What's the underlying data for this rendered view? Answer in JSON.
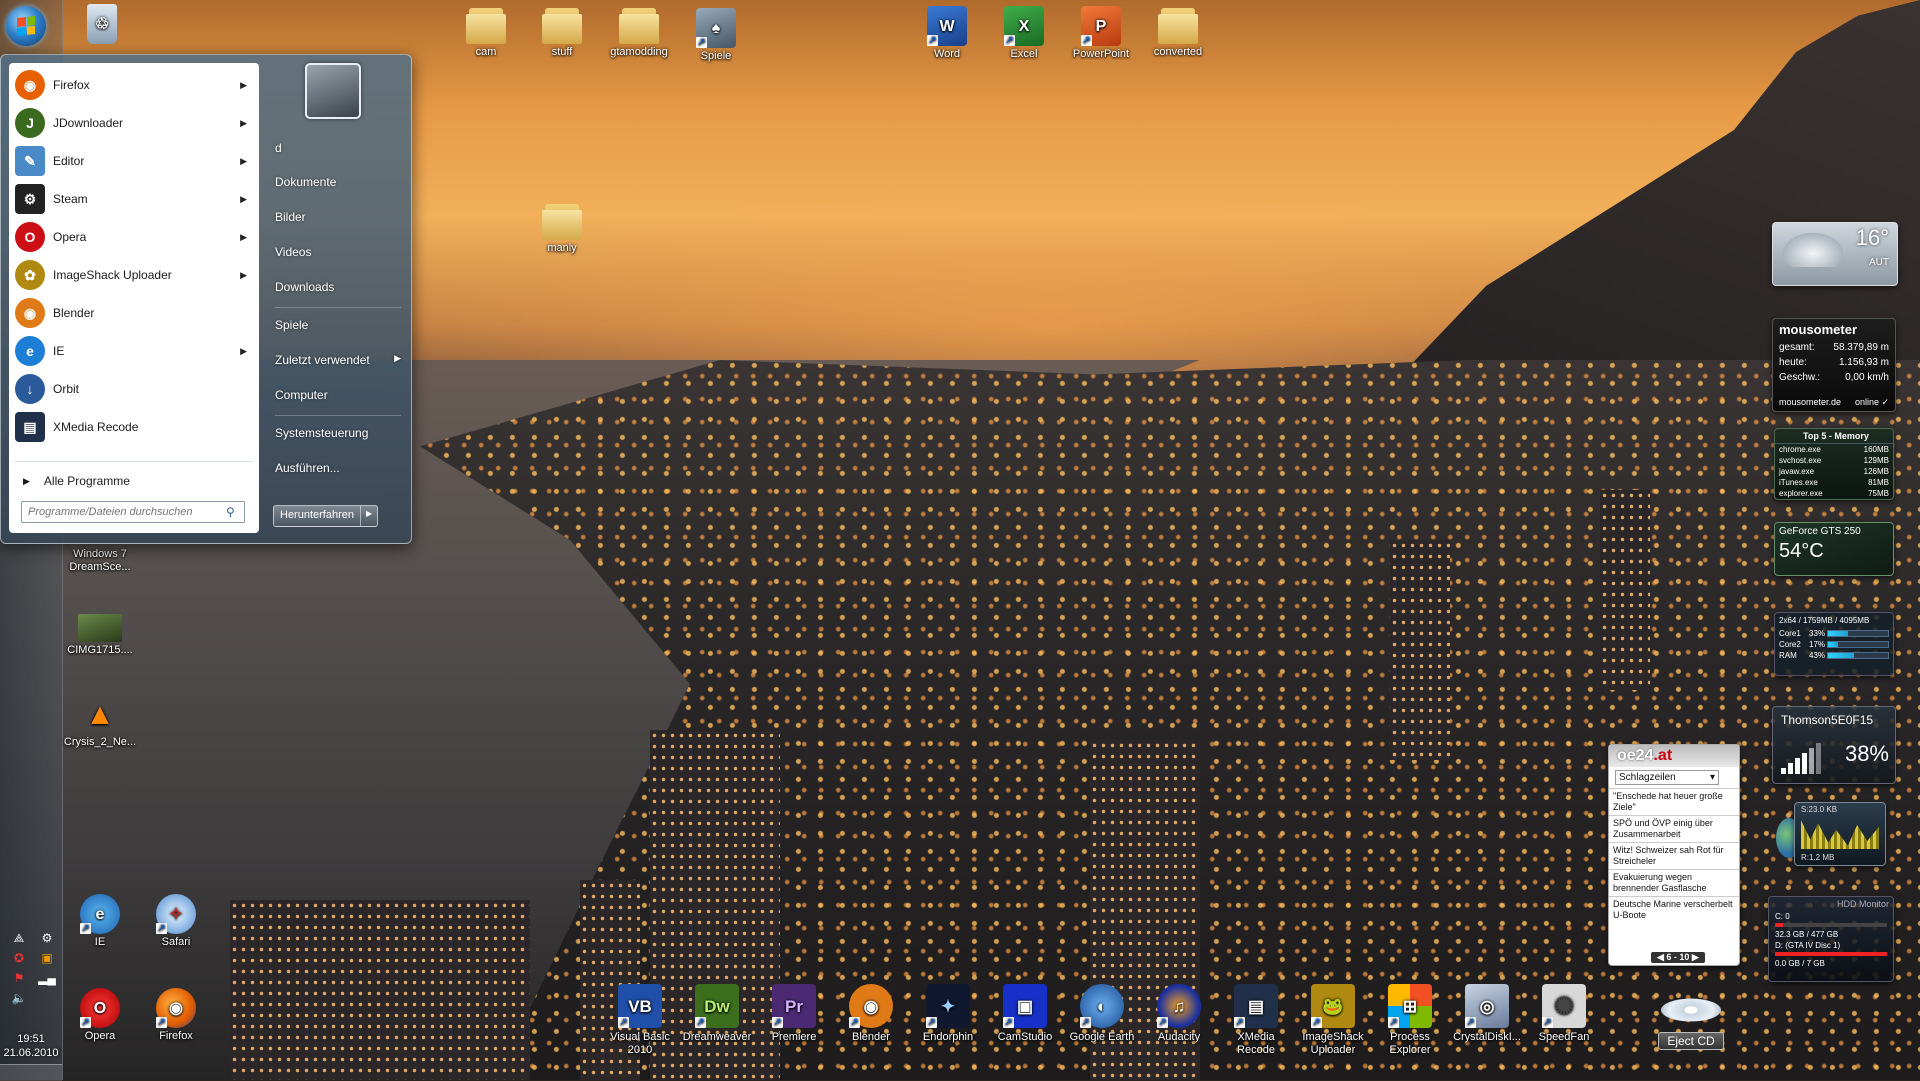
{
  "taskbar": {
    "clock_time": "19:51",
    "clock_date": "21.06.2010",
    "tray_icons": [
      "network-icon",
      "steam-tray-icon",
      "antivirus-icon",
      "package-icon",
      "flag-icon",
      "signal-icon",
      "volume-icon"
    ]
  },
  "desktop": {
    "top_icons": [
      {
        "label": "cam",
        "icon": "folder-icon"
      },
      {
        "label": "stuff",
        "icon": "folder-icon"
      },
      {
        "label": "gtamodding",
        "icon": "folder-icon"
      },
      {
        "label": "Spiele",
        "icon": "games-icon"
      },
      {
        "label": "Word",
        "icon": "word-icon"
      },
      {
        "label": "Excel",
        "icon": "excel-icon"
      },
      {
        "label": "PowerPoint",
        "icon": "powerpoint-icon"
      },
      {
        "label": "converted",
        "icon": "folder-icon"
      },
      {
        "label": "manly",
        "icon": "folder-icon"
      }
    ],
    "left_icons": [
      {
        "label": "Windows 7 DreamSce...",
        "icon": "video-icon"
      },
      {
        "label": "CIMG1715....",
        "icon": "image-icon"
      },
      {
        "label": "Crysis_2_Ne...",
        "icon": "vlc-icon"
      },
      {
        "label": "IE",
        "icon": "ie-icon"
      },
      {
        "label": "Safari",
        "icon": "safari-icon"
      },
      {
        "label": "Opera",
        "icon": "opera-icon"
      },
      {
        "label": "Firefox",
        "icon": "firefox-icon"
      }
    ],
    "bottom_icons": [
      {
        "label": "Visual Basic 2010",
        "icon": "visual-basic-icon",
        "text": "VB",
        "color": "#1f4fa8"
      },
      {
        "label": "Dreamweaver",
        "icon": "dreamweaver-icon",
        "text": "Dw",
        "color": "#3c6e1e"
      },
      {
        "label": "Premiere",
        "icon": "premiere-icon",
        "text": "Pr",
        "color": "#4b2a73"
      },
      {
        "label": "Blender",
        "icon": "blender-icon",
        "text": "◉",
        "color": "#e07a17"
      },
      {
        "label": "Endorphin",
        "icon": "endorphin-icon",
        "text": "✦",
        "color": "#101830"
      },
      {
        "label": "CamStudio",
        "icon": "camstudio-icon",
        "text": "▣",
        "color": "#1630c8"
      },
      {
        "label": "Google Earth",
        "icon": "google-earth-icon",
        "text": "◐",
        "color": "#2b62b0"
      },
      {
        "label": "Audacity",
        "icon": "audacity-icon",
        "text": "♫",
        "color": "#1a2fa0"
      },
      {
        "label": "XMedia Recode",
        "icon": "xmedia-recode-icon",
        "text": "▤",
        "color": "#20304a"
      },
      {
        "label": "ImageShack Uploader",
        "icon": "imageshack-icon",
        "text": "🐸",
        "color": "#b08a10"
      },
      {
        "label": "Process Explorer",
        "icon": "process-explorer-icon",
        "text": "⊞",
        "color": "#3a7bd0"
      },
      {
        "label": "CrystalDiskI...",
        "icon": "crystaldisk-icon",
        "text": "◎",
        "color": "#6a7a9a"
      },
      {
        "label": "SpeedFan",
        "icon": "speedfan-icon",
        "text": "✺",
        "color": "#8a8a8a"
      }
    ]
  },
  "start_menu": {
    "programs": [
      {
        "label": "Firefox",
        "has_submenu": true,
        "icon": "firefox-icon",
        "color": "#e66000",
        "glyph": "◉"
      },
      {
        "label": "JDownloader",
        "has_submenu": true,
        "icon": "jdownloader-icon",
        "color": "#3a6a1e",
        "glyph": "J"
      },
      {
        "label": "Editor",
        "has_submenu": true,
        "icon": "notepad-icon",
        "color": "#4a8ac8",
        "glyph": "✎"
      },
      {
        "label": "Steam",
        "has_submenu": true,
        "icon": "steam-icon",
        "color": "#222222",
        "glyph": "⚙"
      },
      {
        "label": "Opera",
        "has_submenu": true,
        "icon": "opera-icon",
        "color": "#cc0f16",
        "glyph": "O"
      },
      {
        "label": "ImageShack Uploader",
        "has_submenu": true,
        "icon": "imageshack-icon",
        "color": "#b08a10",
        "glyph": "✿"
      },
      {
        "label": "Blender",
        "has_submenu": false,
        "icon": "blender-icon",
        "color": "#e07a17",
        "glyph": "◉"
      },
      {
        "label": "IE",
        "has_submenu": true,
        "icon": "ie-icon",
        "color": "#1d7ed6",
        "glyph": "e"
      },
      {
        "label": "Orbit",
        "has_submenu": false,
        "icon": "orbit-icon",
        "color": "#2a5a9a",
        "glyph": "↓"
      },
      {
        "label": "XMedia Recode",
        "has_submenu": false,
        "icon": "xmedia-recode-icon",
        "color": "#20304a",
        "glyph": "▤"
      }
    ],
    "all_programs": "Alle Programme",
    "search_placeholder": "Programme/Dateien durchsuchen",
    "right_links": [
      {
        "label": "d"
      },
      {
        "label": "Dokumente"
      },
      {
        "label": "Bilder"
      },
      {
        "label": "Videos"
      },
      {
        "label": "Downloads"
      },
      {
        "label": "Spiele"
      },
      {
        "label": "Zuletzt verwendet",
        "has_submenu": true
      },
      {
        "label": "Computer"
      },
      {
        "label": "Systemsteuerung"
      },
      {
        "label": "Ausführen..."
      }
    ],
    "shutdown_label": "Herunterfahren"
  },
  "gadgets": {
    "weather": {
      "temp": "16°",
      "location": "AUT"
    },
    "mousometer": {
      "title": "mousometer",
      "rows": [
        {
          "label": "gesamt:",
          "value": "58.379,89 m"
        },
        {
          "label": "heute:",
          "value": "1.156,93 m"
        },
        {
          "label": "Geschw.:",
          "value": "0,00 km/h"
        }
      ],
      "site": "mousometer.de",
      "status": "online ✓"
    },
    "memory": {
      "title": "Top 5 - Memory",
      "rows": [
        {
          "name": "chrome.exe",
          "value": "160MB"
        },
        {
          "name": "svchost.exe",
          "value": "129MB"
        },
        {
          "name": "javaw.exe",
          "value": "126MB"
        },
        {
          "name": "iTunes.exe",
          "value": "81MB"
        },
        {
          "name": "explorer.exe",
          "value": "75MB"
        }
      ]
    },
    "gpu": {
      "name": "GeForce GTS 250",
      "temp": "54°C"
    },
    "cpu": {
      "header": "2x64 / 1759MB / 4095MB",
      "rows": [
        {
          "name": "Core1",
          "pct": "33%",
          "fill": 0.33
        },
        {
          "name": "Core2",
          "pct": "17%",
          "fill": 0.17
        },
        {
          "name": "RAM",
          "pct": "43%",
          "fill": 0.43
        }
      ]
    },
    "wifi": {
      "name": "Thomson5E0F15",
      "pct": "38%"
    },
    "network": {
      "sent": "S:23.0 KB",
      "received": "R:1.2 MB"
    },
    "hdd": {
      "title": "HDD Monitor",
      "drives": [
        {
          "label": "C: 0",
          "usage": "32.3 GB / 477 GB",
          "fill": 0.07
        },
        {
          "label": "D: (GTA IV Disc 1)",
          "usage": "0.0 GB / 7 GB",
          "fill": 1.0
        }
      ]
    },
    "news": {
      "logo_main": "oe24",
      "logo_suffix": ".at",
      "category": "Schlagzeilen",
      "items": [
        "\"Enschede hat heuer große Ziele\"",
        "SPÖ und ÖVP einig über Zusammenarbeit",
        "Witz! Schweizer sah Rot für Streicheler",
        "Evakuierung wegen brennender Gasflasche",
        "Deutsche Marine verscherbelt U-Boote"
      ],
      "pager": "◀ 6 - 10 ▶"
    },
    "eject": {
      "label": "Eject CD"
    }
  }
}
